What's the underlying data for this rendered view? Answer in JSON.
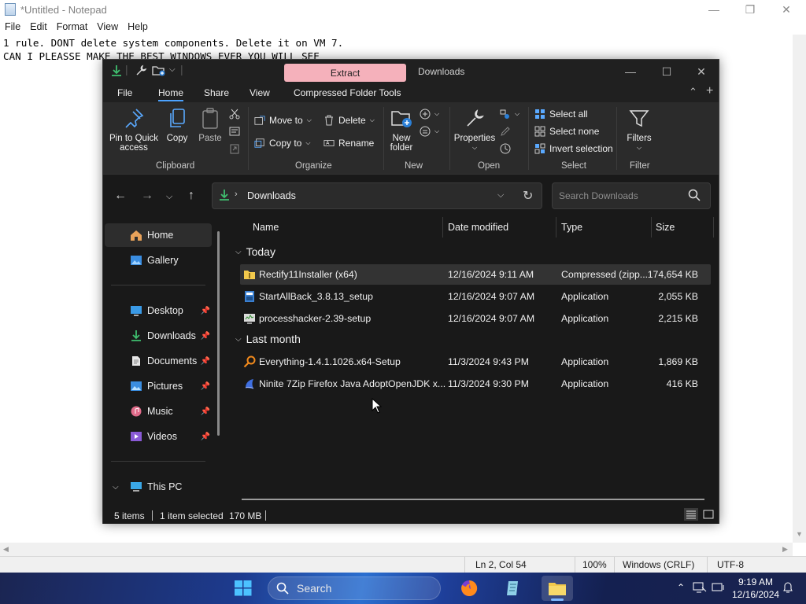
{
  "notepad": {
    "title": "*Untitled - Notepad",
    "menu": [
      "File",
      "Edit",
      "Format",
      "View",
      "Help"
    ],
    "lines": [
      "1 rule. DONT delete system components. Delete it on VM 7.",
      "CAN I PLEASSE MAKE THE BEST WINDOWS EVER YOU WILL SEE"
    ],
    "status": {
      "position": "Ln 2, Col 54",
      "zoom": "100%",
      "line_ending": "Windows (CRLF)",
      "encoding": "UTF-8"
    }
  },
  "explorer": {
    "contextual_tab": "Extract",
    "title": "Downloads",
    "ribbon_tabs": [
      "File",
      "Home",
      "Share",
      "View",
      "Compressed Folder Tools"
    ],
    "ribbon": {
      "pin_label_1": "Pin to Quick",
      "pin_label_2": "access",
      "copy": "Copy",
      "paste": "Paste",
      "move_to": "Move to",
      "copy_to": "Copy to",
      "delete": "Delete",
      "rename": "Rename",
      "new_folder_1": "New",
      "new_folder_2": "folder",
      "properties": "Properties",
      "select_all": "Select all",
      "select_none": "Select none",
      "invert_selection": "Invert selection",
      "filters": "Filters",
      "groups": {
        "clipboard": "Clipboard",
        "organize": "Organize",
        "new": "New",
        "open": "Open",
        "select": "Select",
        "filter": "Filter"
      }
    },
    "address": "Downloads",
    "search_placeholder": "Search Downloads",
    "sidebar": {
      "home": "Home",
      "gallery": "Gallery",
      "desktop": "Desktop",
      "downloads": "Downloads",
      "documents": "Documents",
      "pictures": "Pictures",
      "music": "Music",
      "videos": "Videos",
      "this_pc": "This PC"
    },
    "columns": {
      "name": "Name",
      "date": "Date modified",
      "type": "Type",
      "size": "Size"
    },
    "groups": {
      "today": "Today",
      "last_month": "Last month"
    },
    "files": [
      {
        "name": "Rectify11Installer (x64)",
        "date": "12/16/2024 9:11 AM",
        "type": "Compressed (zipp...",
        "size": "174,654 KB",
        "icon": "zip-folder-icon"
      },
      {
        "name": "StartAllBack_3.8.13_setup",
        "date": "12/16/2024 9:07 AM",
        "type": "Application",
        "size": "2,055 KB",
        "icon": "installer-icon"
      },
      {
        "name": "processhacker-2.39-setup",
        "date": "12/16/2024 9:07 AM",
        "type": "Application",
        "size": "2,215 KB",
        "icon": "monitor-app-icon"
      },
      {
        "name": "Everything-1.4.1.1026.x64-Setup",
        "date": "11/3/2024 9:43 PM",
        "type": "Application",
        "size": "1,869 KB",
        "icon": "magnifier-app-icon"
      },
      {
        "name": "Ninite 7Zip Firefox Java AdoptOpenJDK x...",
        "date": "11/3/2024 9:30 PM",
        "type": "Application",
        "size": "416 KB",
        "icon": "ninite-icon"
      }
    ],
    "status": {
      "items": "5 items",
      "selected": "1 item selected",
      "size": "170 MB"
    }
  },
  "taskbar": {
    "search": "Search",
    "time": "9:19 AM",
    "date": "12/16/2024"
  },
  "colors": {
    "accent": "#4da3ff",
    "explorer_bg": "#191919",
    "ribbon_bg": "#2b2b2b",
    "extract_tab": "#f5b1bb"
  }
}
